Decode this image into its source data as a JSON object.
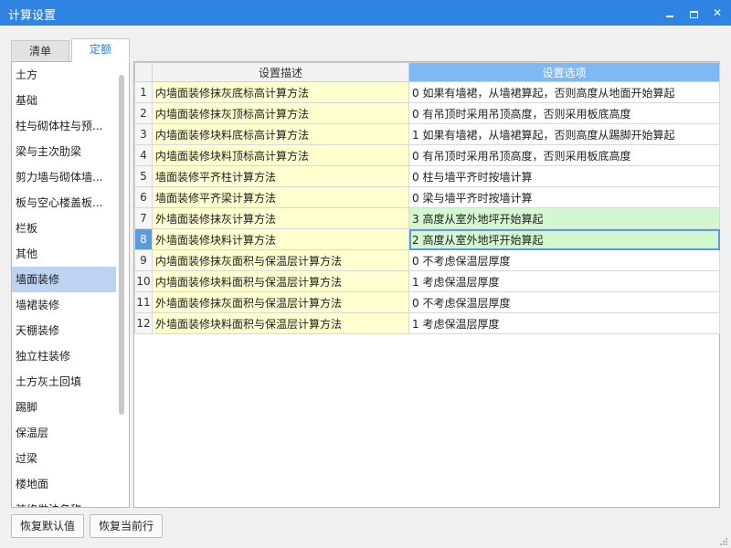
{
  "window": {
    "title": "计算设置",
    "min_icon": "minimize-icon",
    "max_icon": "maximize-icon",
    "close_icon": "close-icon",
    "close_glyph": "✕"
  },
  "tabs": [
    {
      "label": "清单",
      "active": false
    },
    {
      "label": "定额",
      "active": true
    }
  ],
  "sidebar": {
    "selected_index": 8,
    "items": [
      "土方",
      "基础",
      "柱与砌体柱与预...",
      "梁与主次肋梁",
      "剪力墙与砌体墙...",
      "板与空心楼盖板...",
      "栏板",
      "其他",
      "墙面装修",
      "墙裙装修",
      "天棚装修",
      "独立柱装修",
      "土方灰土回填",
      "踢脚",
      "保温层",
      "过梁",
      "楼地面",
      "装修做法名称..."
    ]
  },
  "grid": {
    "headers": {
      "num": "",
      "desc": "设置描述",
      "option": "设置选项"
    },
    "current_row": 8,
    "rows": [
      {
        "num": "1",
        "desc": "内墙面装修抹灰底标高计算方法",
        "option": "0 如果有墙裙，从墙裙算起，否则高度从地面开始算起",
        "highlight": false
      },
      {
        "num": "2",
        "desc": "内墙面装修抹灰顶标高计算方法",
        "option": "0 有吊顶时采用吊顶高度，否则采用板底高度",
        "highlight": false
      },
      {
        "num": "3",
        "desc": "内墙面装修块料底标高计算方法",
        "option": "1 如果有墙裙，从墙裙算起，否则高度从踢脚开始算起",
        "highlight": false
      },
      {
        "num": "4",
        "desc": "内墙面装修块料顶标高计算方法",
        "option": "0 有吊顶时采用吊顶高度，否则采用板底高度",
        "highlight": false
      },
      {
        "num": "5",
        "desc": "墙面装修平齐柱计算方法",
        "option": "0 柱与墙平齐时按墙计算",
        "highlight": false
      },
      {
        "num": "6",
        "desc": "墙面装修平齐梁计算方法",
        "option": "0 梁与墙平齐时按墙计算",
        "highlight": false
      },
      {
        "num": "7",
        "desc": "外墙面装修抹灰计算方法",
        "option": "3 高度从室外地坪开始算起",
        "highlight": true
      },
      {
        "num": "8",
        "desc": "外墙面装修块料计算方法",
        "option": "2 高度从室外地坪开始算起",
        "highlight": true
      },
      {
        "num": "9",
        "desc": "内墙面装修抹灰面积与保温层计算方法",
        "option": "0 不考虑保温层厚度",
        "highlight": false
      },
      {
        "num": "10",
        "desc": "内墙面装修块料面积与保温层计算方法",
        "option": "1 考虑保温层厚度",
        "highlight": false
      },
      {
        "num": "11",
        "desc": "外墙面装修抹灰面积与保温层计算方法",
        "option": "0 不考虑保温层厚度",
        "highlight": false
      },
      {
        "num": "12",
        "desc": "外墙面装修块料面积与保温层计算方法",
        "option": "1 考虑保温层厚度",
        "highlight": false
      }
    ]
  },
  "footer": {
    "restore_default": "恢复默认值",
    "restore_current": "恢复当前行"
  },
  "colors": {
    "titlebar": "#2f83e3",
    "desc_cell": "#ffffcf",
    "highlight_cell": "#d3f8cf",
    "header_selected": "#7eb9f3",
    "selected_sidebar": "#bcd4f2",
    "current_row_marker": "#5a9bdc"
  }
}
